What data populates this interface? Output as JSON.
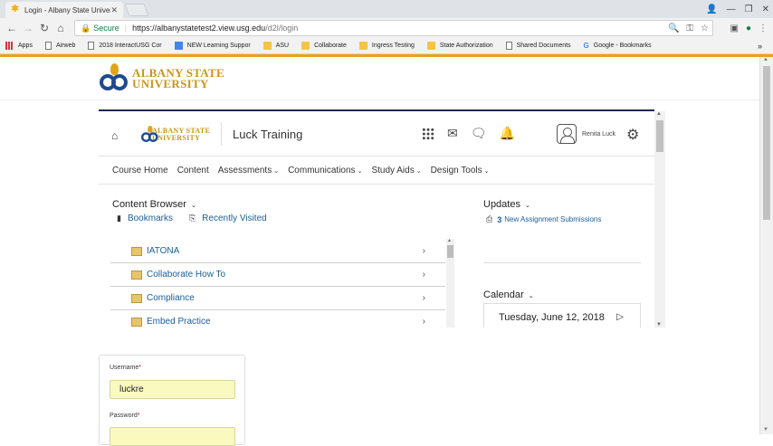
{
  "browser": {
    "tab_title": "Login - Albany State Univer",
    "url_secure_label": "Secure",
    "url_host": "https://albanystatetest2.view.usg.edu",
    "url_path": "/d2l/login",
    "bookmarks": [
      {
        "label": "Apps",
        "icon": "apps-icon"
      },
      {
        "label": "Airweb",
        "icon": "page-icon"
      },
      {
        "label": "2018 InteractUSG Cor",
        "icon": "page-icon"
      },
      {
        "label": "NEW Learning Suppor",
        "icon": "doc-icon"
      },
      {
        "label": "ASU",
        "icon": "folder-icon"
      },
      {
        "label": "Collaborate",
        "icon": "folder-icon"
      },
      {
        "label": "Ingress Testing",
        "icon": "folder-icon"
      },
      {
        "label": "State Authorization",
        "icon": "folder-icon"
      },
      {
        "label": "Shared Documents",
        "icon": "page-icon"
      },
      {
        "label": "Google - Bookmarks",
        "icon": "google-icon"
      }
    ],
    "bookmarks_more": "»"
  },
  "brand": {
    "line1": "ALBANY STATE",
    "line2": "UNIVERSITY"
  },
  "d2l": {
    "course_title": "Luck Training",
    "user_name": "Renita Luck",
    "menu": [
      "Course Home",
      "Content",
      "Assessments",
      "Communications",
      "Study Aids",
      "Design Tools"
    ],
    "content_browser": {
      "title": "Content Browser",
      "bookmarks_label": "Bookmarks",
      "recent_label": "Recently Visited",
      "items": [
        "IATONA",
        "Collaborate How To",
        "Compliance",
        "Embed Practice"
      ]
    },
    "updates": {
      "title": "Updates",
      "count": "3",
      "text": "New Assignment Submissions"
    },
    "calendar": {
      "title": "Calendar",
      "date": "Tuesday, June 12, 2018"
    }
  },
  "login": {
    "username_label": "Username",
    "username_value": "luckre",
    "password_label": "Password",
    "required_mark": "*"
  }
}
